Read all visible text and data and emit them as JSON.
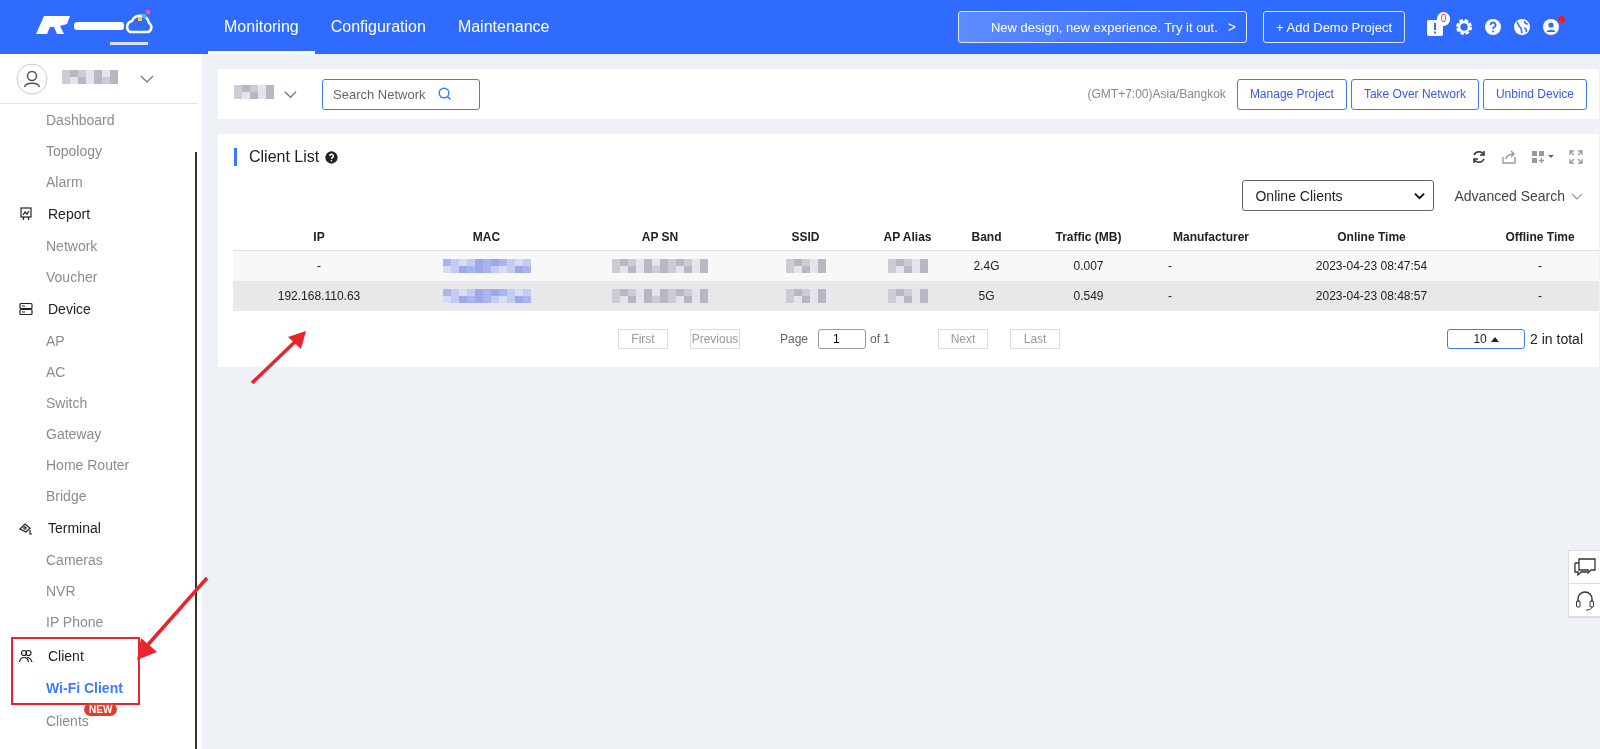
{
  "top_nav": {
    "tabs": [
      {
        "label": "Monitoring",
        "selected": true
      },
      {
        "label": "Configuration",
        "selected": false
      },
      {
        "label": "Maintenance",
        "selected": false
      }
    ],
    "promo_button": "New design, new experience. Try it out.",
    "promo_chevron": ">",
    "demo_button": "+ Add Demo Project",
    "notification_count": "0",
    "user_alert": true
  },
  "sidebar": {
    "account": {
      "blurred": true
    },
    "items": [
      {
        "kind": "sub",
        "label": "Dashboard",
        "selected": false
      },
      {
        "kind": "sub",
        "label": "Topology",
        "selected": false
      },
      {
        "kind": "sub",
        "label": "Alarm",
        "selected": false
      },
      {
        "kind": "group",
        "label": "Report",
        "children": [
          {
            "label": "Network",
            "selected": false
          },
          {
            "label": "Voucher",
            "selected": false
          }
        ]
      },
      {
        "kind": "group",
        "label": "Device",
        "children": [
          {
            "label": "AP",
            "selected": false
          },
          {
            "label": "AC",
            "selected": false
          },
          {
            "label": "Switch",
            "selected": false
          },
          {
            "label": "Gateway",
            "selected": false
          },
          {
            "label": "Home Router",
            "selected": false
          },
          {
            "label": "Bridge",
            "selected": false
          }
        ]
      },
      {
        "kind": "group",
        "label": "Terminal",
        "children": [
          {
            "label": "Cameras",
            "selected": false
          },
          {
            "label": "NVR",
            "selected": false
          },
          {
            "label": "IP Phone",
            "selected": false
          }
        ]
      },
      {
        "kind": "group",
        "label": "Client",
        "framed": true,
        "children": [
          {
            "label": "Wi-Fi Client",
            "selected": true
          }
        ]
      },
      {
        "kind": "sub",
        "label": "Clients",
        "selected": false,
        "badge": "NEW"
      }
    ]
  },
  "toolbar": {
    "network_selector": {
      "blurred": true
    },
    "search": {
      "placeholder": "Search Network"
    },
    "timezone": "(GMT+7:00)Asia/Bangkok",
    "buttons": [
      "Manage Project",
      "Take Over Network",
      "Unbind Device"
    ]
  },
  "client_list": {
    "title": "Client List",
    "filter": "Online Clients",
    "advanced_search": "Advanced Search",
    "columns": [
      "IP",
      "MAC",
      "AP SN",
      "SSID",
      "AP Alias",
      "Band",
      "Traffic (MB)",
      "Manufacturer",
      "Online Time",
      "Offline Time"
    ],
    "rows": [
      {
        "hovered": false,
        "cells": [
          {
            "text": "-"
          },
          {
            "blurred": true
          },
          {
            "blurred": true
          },
          {
            "blurred": true
          },
          {
            "blurred": true
          },
          {
            "text": "2.4G"
          },
          {
            "text": "0.007"
          },
          {
            "text": "-"
          },
          {
            "text": "2023-04-23 08:47:54"
          },
          {
            "text": "-"
          }
        ]
      },
      {
        "hovered": true,
        "cells": [
          {
            "text": "192.168.110.63"
          },
          {
            "blurred": true
          },
          {
            "blurred": true
          },
          {
            "blurred": true
          },
          {
            "blurred": true
          },
          {
            "text": "5G"
          },
          {
            "text": "0.549"
          },
          {
            "text": "-"
          },
          {
            "text": "2023-04-23 08:48:57"
          },
          {
            "text": "-"
          }
        ]
      }
    ],
    "pagination": {
      "first": "First",
      "previous": "Previous",
      "page_label": "Page",
      "page": "1",
      "of": "of 1",
      "next": "Next",
      "last": "Last",
      "page_size": "10",
      "total": "2 in total"
    }
  }
}
